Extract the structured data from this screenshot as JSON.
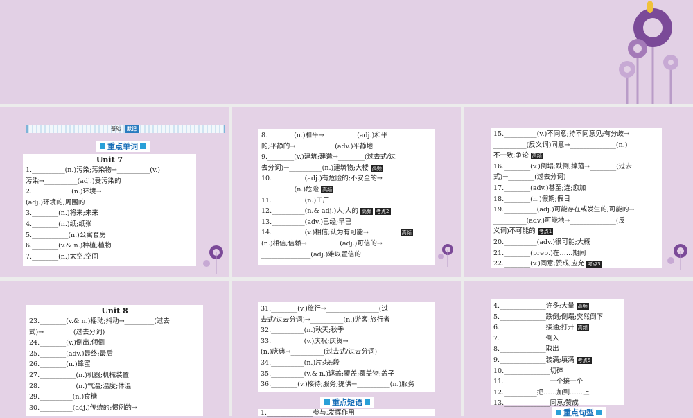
{
  "banner": {
    "left_label": "基础",
    "right_label": "默记"
  },
  "sections": {
    "words": "重点单词",
    "phrases": "重点短语",
    "sentences": "重点句型"
  },
  "panel1": {
    "unit": "Unit 7",
    "lines": [
      "1.__________(n.)污染;污染物→__________(v.)",
      "污染→__________(adj.)受污染的",
      "2.____________(n.)环境→________________",
      "(adj.)环境的;周围的",
      "3.________(n.)将来;未来",
      "4.________(n.)纸;纸张",
      "5.___________(n.)公寓套房",
      "6.________(v.& n.)种植;植物",
      "7.________(n.)太空;空间"
    ]
  },
  "panel2": {
    "lines": [
      "8.________(n.)和平→__________(adj.)和平",
      "的;平静的→____________(adv.)平静地",
      "9.________(v.)建筑;建造→________(过去式/过",
      "去分词)→__________(n.)建筑物;大楼",
      "10.__________(adj.)有危险的;不安全的→",
      "__________(n.)危险",
      "11.__________(n.)工厂",
      "12.__________(n.& adj.)人;人的",
      "13.__________(adv.)已经;早已",
      "14.__________(v.)相信;认为有可能→_________",
      "(n.)相信;信赖→__________(adj.)可信的→",
      "_______________(adj.)难以置信的"
    ],
    "tags": [
      "高频",
      "高频",
      "高频",
      "高频",
      "考点2",
      "高频"
    ]
  },
  "panel3": {
    "lines": [
      "15.__________(v.)不同意;持不同意见;有分歧→",
      "__________(反义词)同意→______________(n.)",
      "不一致;争论",
      "16.________(v.)倒塌;跌倒;掉落→________(过去",
      "式)→________(过去分词)",
      "17.________(adv.)甚至;连;愈加",
      "18.________(n.)假期;假日",
      "19.__________(adj.)可能存在或发生的;可能的→",
      "__________(adv.)可能地→______________(反",
      "义词)不可能的",
      "20.__________(adv.)很可能;大概",
      "21.________(prep.)在……期间",
      "22.________(v.)同意;赞成;应允"
    ],
    "tags": [
      "高频",
      "考点1",
      "考点3"
    ]
  },
  "panel4": {
    "unit": "Unit 8",
    "lines": [
      "23.________(v.& n.)摇动;抖动→_________(过去",
      "式)→_________(过去分词)",
      "24.________(v.)倒出;倾倒",
      "25.________(adv.)最终;最后",
      "26.________(n.)蜂蜜",
      "27.___________(n.)机器;机械装置",
      "28.___________(n.)气温;温度;体温",
      "29.__________(n.)食糖",
      "30.__________(adj.)传统的;惯例的→"
    ]
  },
  "panel5": {
    "lines": [
      "31.________(v.)旅行→________________(过",
      "去式/过去分词)→__________(n.)游客;旅行者",
      "32.__________(n.)秋天;秋季",
      "33.__________(v.)庆祝;庆贺→______________",
      "(n.)庆典→__________(过去式/过去分词)",
      "34.__________(n.)片;块;段",
      "35.__________(v.& n.)遮盖;覆盖;覆盖物;盖子",
      "36.________(v.)接待;服务;提供→__________(n.)服务"
    ],
    "phrase_first": "1.______________参与;发挥作用"
  },
  "panel6": {
    "lines": [
      "4.______________许多;大量",
      "5.______________跌倒;倒塌;突然倒下",
      "6.______________接通;打开",
      "7.______________倒入",
      "8.______________取出",
      "9.______________装满;填满",
      "10.______________切碎",
      "11.______________一个接一个",
      "12.__________把……加到……上",
      "13.______________同意;赞成"
    ],
    "tags": [
      "高频",
      "高频",
      "考点5"
    ]
  }
}
